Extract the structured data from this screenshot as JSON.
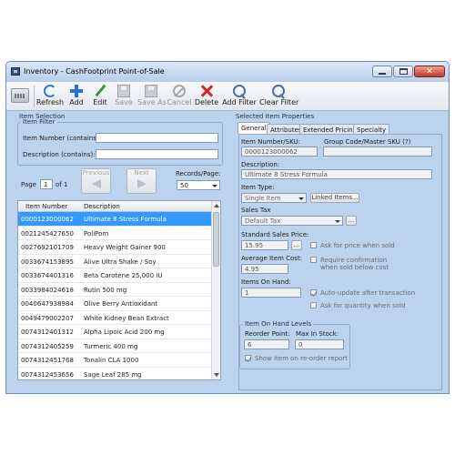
{
  "window": {
    "title": "Inventory - CashFootprint Point-of-Sale"
  },
  "toolbar": {
    "buttons": [
      {
        "label": "Refresh"
      },
      {
        "label": "Add"
      },
      {
        "label": "Edit"
      },
      {
        "label": "Save"
      },
      {
        "label": "Save As"
      },
      {
        "label": "Cancel"
      },
      {
        "label": "Delete"
      },
      {
        "label": "Add Filter"
      },
      {
        "label": "Clear Filter"
      }
    ]
  },
  "item_selection": {
    "heading": "Item Selection",
    "filter_heading": "Item Filter",
    "item_number_label": "Item Number (contains):",
    "item_number_value": "",
    "description_label": "Description (contains):",
    "description_value": "",
    "page_label": "Page",
    "page_value": "1",
    "page_of": "of 1",
    "previous_label": "Previous",
    "next_label": "Next",
    "records_per_page_label": "Records/Page:",
    "records_per_page_value": "50",
    "columns": [
      "Item Number",
      "Description"
    ],
    "rows": [
      {
        "number": "0000123000062",
        "desc": "Ultimate 8 Stress Formula"
      },
      {
        "number": "002124542765​0",
        "desc": "PoliPom"
      },
      {
        "number": "0027692101709",
        "desc": "Heavy Weight Gainer 900"
      },
      {
        "number": "0033674153895",
        "desc": "Alive Ultra Shake / Soy"
      },
      {
        "number": "0033674401316",
        "desc": "Beta Carotene 25,000 IU"
      },
      {
        "number": "0033984024618",
        "desc": "Rutin 500 mg"
      },
      {
        "number": "0040647938984",
        "desc": "Olive Berry Antioxidant"
      },
      {
        "number": "0049479002207",
        "desc": "White Kidney Bean Extract"
      },
      {
        "number": "0074312401312",
        "desc": "Alpha Lipoic Acid 200 mg"
      },
      {
        "number": "0074312405259",
        "desc": "Turmeric 400 mg"
      },
      {
        "number": "0074312451768",
        "desc": "Tonalin CLA 1000"
      },
      {
        "number": "0074312453656",
        "desc": "Sage Leaf 285 mg"
      }
    ]
  },
  "properties": {
    "heading": "Selected Item Properties",
    "tabs": [
      "General",
      "Attributes",
      "Extended Pricing",
      "Specialty"
    ],
    "item_number_label": "Item Number/SKU:",
    "item_number_value": "0000123000062",
    "group_code_label": "Group Code/Master SKU (?)",
    "group_code_value": "",
    "description_label": "Description:",
    "description_value": "Ultimate 8 Stress Formula",
    "item_type_label": "Item Type:",
    "item_type_value": "Single Item",
    "linked_items_label": "Linked Items...",
    "sales_tax_label": "Sales Tax",
    "sales_tax_value": "Default Tax",
    "ellipsis": "...",
    "std_price_label": "Standard Sales Price:",
    "std_price_value": "15.95",
    "ask_price_label": "Ask for price when sold",
    "avg_cost_label": "Average Item Cost:",
    "avg_cost_value": "4.95",
    "require_confirm_label": "Require confirmation when sold below cost",
    "items_on_hand_label": "Items On Hand:",
    "items_on_hand_value": "1",
    "auto_update_label": "Auto-update after transaction",
    "ask_quantity_label": "Ask for quantity when sold",
    "levels_heading": "Item On Hand Levels",
    "reorder_label": "Reorder Point:",
    "reorder_value": "6",
    "max_stock_label": "Max In Stock:",
    "max_stock_value": "0",
    "show_reorder_label": "Show item on re-order report"
  }
}
